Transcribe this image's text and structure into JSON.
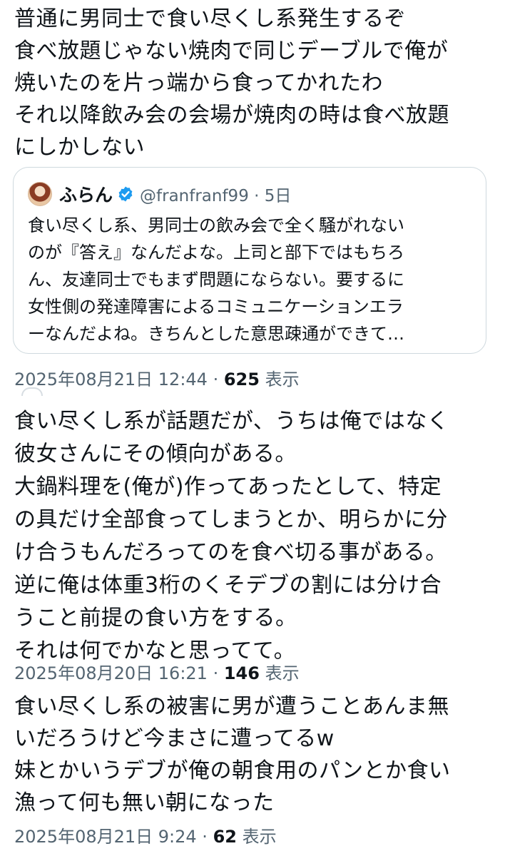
{
  "tweets": [
    {
      "text": "普通に男同士で食い尽くし系発生するぞ\n食べ放題じゃない焼肉で同じデーブルで俺が\n焼いたのを片っ端から食ってかれたわ\nそれ以降飲み会の会場が焼肉の時は食べ放題\nにしかしない",
      "quote": {
        "display_name": "ふらん",
        "handle_time": "@franfranf99 · 5日",
        "text": "食い尽くし系、男同士の飲み会で全く騒がれない\nのが『答え』なんだよな。上司と部下ではもちろ\nん、友達同士でもまず問題にならない。要するに\n女性側の発達障害によるコミュニケーションエラ\nーなんだよね。きちんとした意思疎通ができて…"
      },
      "timestamp": "2025年08月21日 12:44 · ",
      "views_count": "625",
      "views_label": " 表示"
    },
    {
      "text": "食い尽くし系が話題だが、うちは俺ではなく\n彼女さんにその傾向がある。\n大鍋料理を(俺が)作ってあったとして、特定\nの具だけ全部食ってしまうとか、明らかに分\nけ合うもんだろってのを食べ切る事がある。\n逆に俺は体重3桁のくそデブの割には分け合\nうこと前提の食い方をする。\nそれは何でかなと思ってて。",
      "timestamp": "2025年08月20日 16:21 · ",
      "views_count": "146",
      "views_label": " 表示"
    },
    {
      "text": "食い尽くし系の被害に男が遭うことあんま無\nいだろうけど今まさに遭ってるw\n妹とかいうデブが俺の朝食用のパンとか食い\n漁って何も無い朝になった",
      "timestamp": "2025年08月21日 9:24 · ",
      "views_count": "62",
      "views_label": " 表示"
    }
  ],
  "icons": {
    "verified": "verified-badge-icon",
    "avatar": "profile-avatar"
  },
  "colors": {
    "text": "#0f1419",
    "secondary": "#536471",
    "verified_blue": "#1d9bf0",
    "border": "#cfd9de"
  }
}
